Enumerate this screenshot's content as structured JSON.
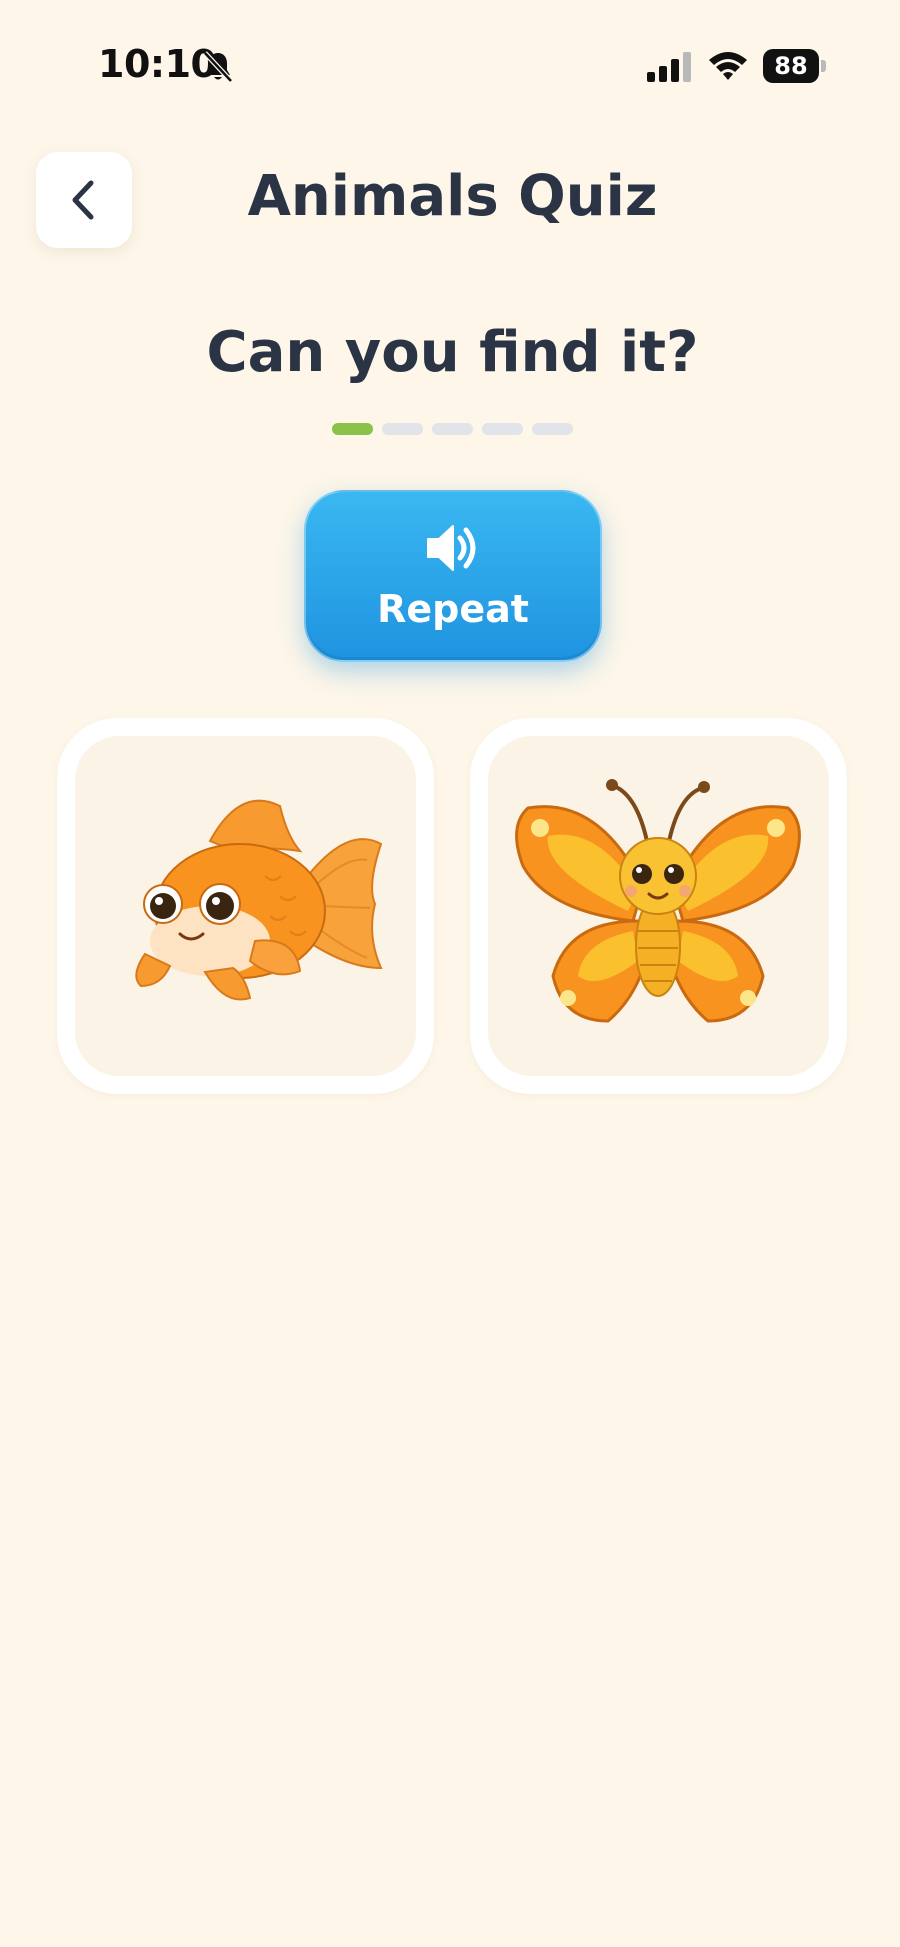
{
  "status_bar": {
    "time": "10:10",
    "battery": "88",
    "icons": [
      "bell-slash-icon",
      "cellular-signal-icon",
      "wifi-icon",
      "battery-icon"
    ]
  },
  "header": {
    "back_icon": "chevron-left-icon",
    "title": "Animals Quiz"
  },
  "quiz": {
    "question": "Can you find it?",
    "progress": {
      "current": 1,
      "total": 5
    },
    "repeat_button": {
      "label": "Repeat",
      "icon": "speaker-icon"
    },
    "options": [
      {
        "animal": "fish",
        "icon": "goldfish-image"
      },
      {
        "animal": "butterfly",
        "icon": "butterfly-image"
      }
    ]
  },
  "colors": {
    "background": "#fdf6e9",
    "title_text": "#2b3444",
    "progress_active": "#8bc34a",
    "progress_inactive": "#e1e4e8",
    "repeat_button": "#2ba6ea"
  }
}
